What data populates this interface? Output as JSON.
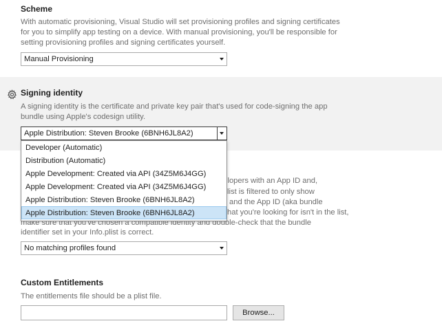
{
  "scheme": {
    "title": "Scheme",
    "description": [
      "With automatic provisioning, Visual Studio will set provisioning profiles and signing certificates",
      "for you to simplify app testing on a device. With manual provisioning, you'll be responsible for",
      "setting provisioning profiles and signing certificates yourself."
    ],
    "selected": "Manual Provisioning"
  },
  "signing_identity": {
    "title": "Signing identity",
    "icon": "gear-icon",
    "description": [
      "A signing identity is the certificate and private key pair that's used for code-signing the app",
      "bundle using Apple's codesign utility."
    ],
    "selected": "Apple Distribution: Steven Brooke (6BNH6JL8A2)",
    "options": [
      "Developer (Automatic)",
      "Distribution (Automatic)",
      "Apple Development: Created via API (34Z5M6J4GG)",
      "Apple Development: Created via API (34Z5M6J4GG)",
      "Apple Distribution: Steven Brooke (6BNH6JL8A2)",
      "Apple Distribution: Steven Brooke (6BNH6JL8A2)"
    ],
    "highlighted_index": 5
  },
  "provisioning_profile": {
    "description_fragments": {
      "line1": "f developers with an App ID and,",
      "line2": "list is filtered to only show",
      "line3": "and the App ID (aka bundle",
      "line4": "hat you're looking for isn't in the list,",
      "line5": "make sure that you've chosen a compatible identity and double-check that the bundle",
      "line6": "identifier set in your Info.plist is correct."
    },
    "selected": "No matching profiles found"
  },
  "custom_entitlements": {
    "title": "Custom Entitlements",
    "description": "The entitlements file should be a plist file.",
    "value": "",
    "browse_label": "Browse..."
  },
  "colors": {
    "band": "#f2f2f2",
    "highlight": "#cce4f7",
    "muted_text": "#6d6d6d"
  }
}
